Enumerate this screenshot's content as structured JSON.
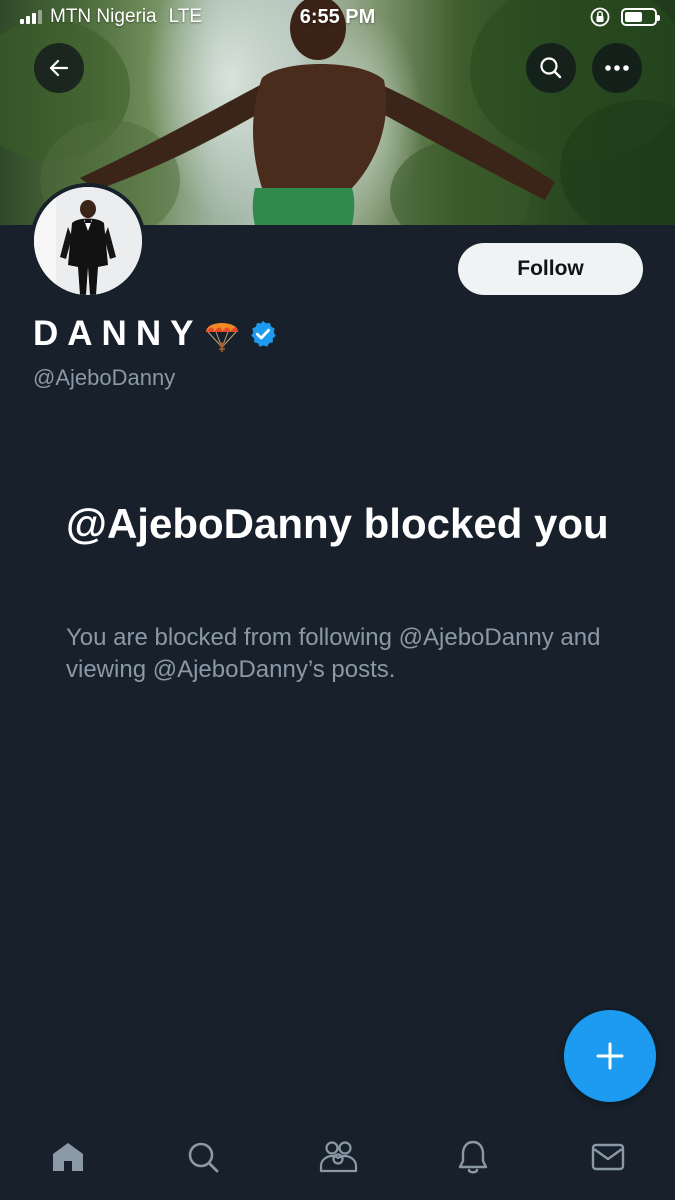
{
  "status_bar": {
    "carrier": "MTN Nigeria",
    "network": "LTE",
    "time": "6:55 PM"
  },
  "header": {
    "back_icon": "arrow-left-icon",
    "search_icon": "search-icon",
    "more_icon": "more-horizontal-icon"
  },
  "profile": {
    "display_name": "DANNY",
    "name_emoji": "🪂",
    "verified": true,
    "handle": "@AjeboDanny",
    "follow_label": "Follow"
  },
  "blocked": {
    "title": "@AjeboDanny blocked you",
    "description": "You are blocked from following @AjeboDanny and viewing @AjeboDanny’s posts."
  },
  "fab": {
    "icon": "plus-icon"
  },
  "tabs": [
    {
      "name": "home",
      "icon": "home-icon",
      "active": true
    },
    {
      "name": "search",
      "icon": "search-icon",
      "active": false
    },
    {
      "name": "communities",
      "icon": "communities-icon",
      "active": false
    },
    {
      "name": "notifications",
      "icon": "bell-icon",
      "active": false
    },
    {
      "name": "messages",
      "icon": "mail-icon",
      "active": false
    }
  ],
  "colors": {
    "background": "#17202b",
    "accent": "#1d9bf0",
    "muted_text": "#8b98a5",
    "follow_bg": "#eff3f4"
  }
}
